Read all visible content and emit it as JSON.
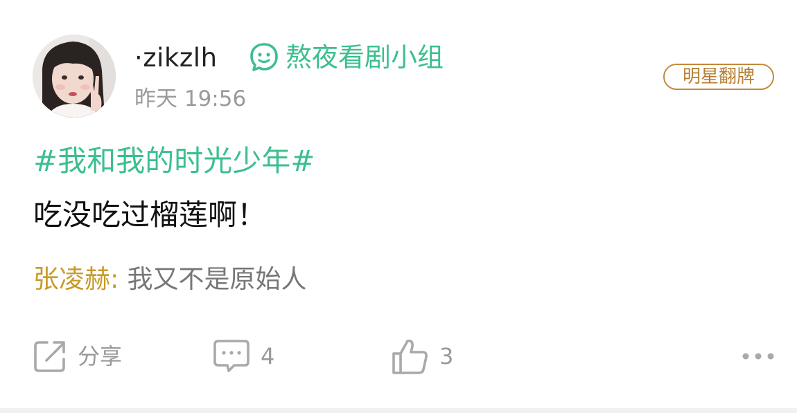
{
  "post": {
    "user": {
      "name": "·zikzlh",
      "avatar_icon": "user-avatar-photo"
    },
    "group": {
      "icon": "smiley-bubble-icon",
      "name": "熬夜看剧小组",
      "color": "#3cbf8f"
    },
    "time": "昨天 19:56",
    "badge": {
      "label": "明星翻牌",
      "color": "#b57e2f"
    },
    "hashtag": "#我和我的时光少年#",
    "text": "吃没吃过榴莲啊！",
    "reply": {
      "author": "张凌赫",
      "separator": ":",
      "text": "我又不是原始人",
      "author_color": "#c89a2a"
    }
  },
  "actions": {
    "share": {
      "icon": "share-icon",
      "label": "分享"
    },
    "comment": {
      "icon": "comment-icon",
      "count": "4"
    },
    "like": {
      "icon": "thumbs-up-icon",
      "count": "3"
    },
    "more": {
      "icon": "more-dots-icon"
    }
  }
}
